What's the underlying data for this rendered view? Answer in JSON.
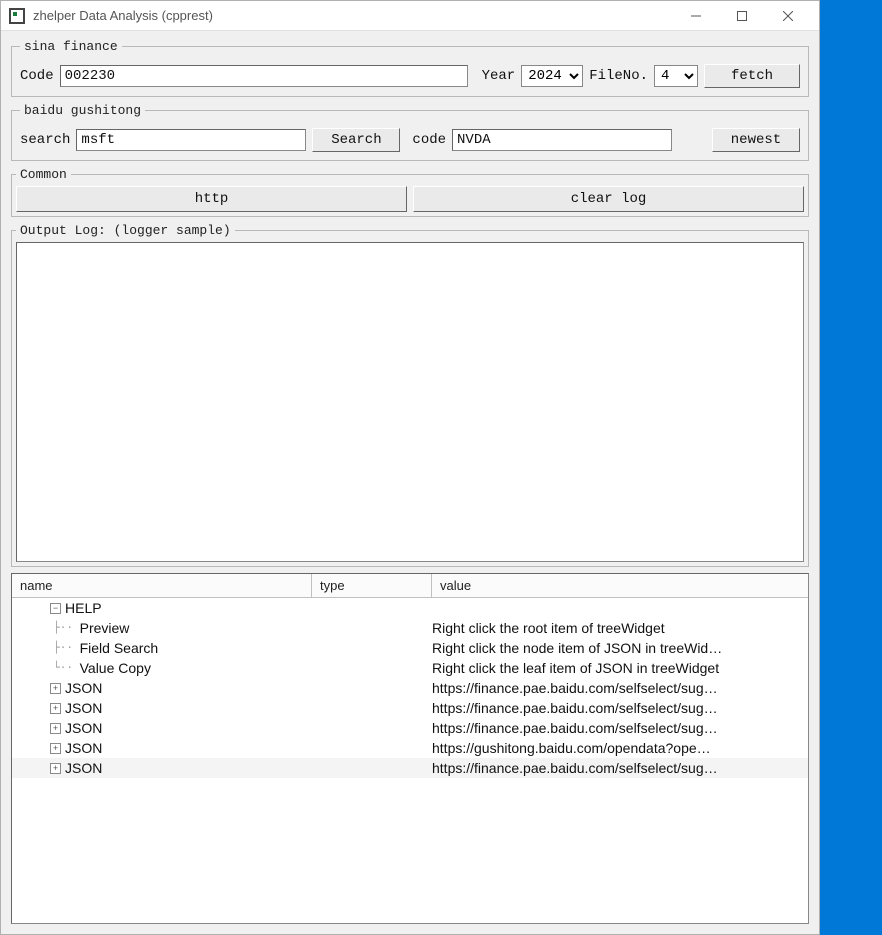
{
  "window": {
    "title": "zhelper Data Analysis (cpprest)"
  },
  "sina": {
    "legend": "sina finance",
    "code_label": "Code",
    "code_value": "002230",
    "year_label": "Year",
    "year_value": "2024",
    "fileno_label": "FileNo.",
    "fileno_value": "4",
    "fetch_label": "fetch"
  },
  "baidu": {
    "legend": "baidu gushitong",
    "search_label": "search",
    "search_value": "msft",
    "search_btn_label": "Search",
    "code_label": "code",
    "code_value": "NVDA",
    "newest_label": "newest"
  },
  "common": {
    "legend": "Common",
    "http_label": "http",
    "clear_label": "clear log"
  },
  "log": {
    "legend": "Output Log: (logger sample)"
  },
  "tree": {
    "headers": {
      "name": "name",
      "type": "type",
      "value": "value"
    },
    "root_name": "HELP",
    "children": [
      {
        "name": "Preview",
        "value": "Right click the root item of treeWidget"
      },
      {
        "name": "Field Search",
        "value": "Right click the node item of JSON in treeWid…"
      },
      {
        "name": "Value Copy",
        "value": "Right click the leaf item of JSON in treeWidget"
      }
    ],
    "json_rows": [
      {
        "name": "JSON",
        "value": "https://finance.pae.baidu.com/selfselect/sug…"
      },
      {
        "name": "JSON",
        "value": "https://finance.pae.baidu.com/selfselect/sug…"
      },
      {
        "name": "JSON",
        "value": "https://finance.pae.baidu.com/selfselect/sug…"
      },
      {
        "name": "JSON",
        "value": "https://gushitong.baidu.com/opendata?ope…"
      },
      {
        "name": "JSON",
        "value": "https://finance.pae.baidu.com/selfselect/sug…"
      }
    ]
  }
}
